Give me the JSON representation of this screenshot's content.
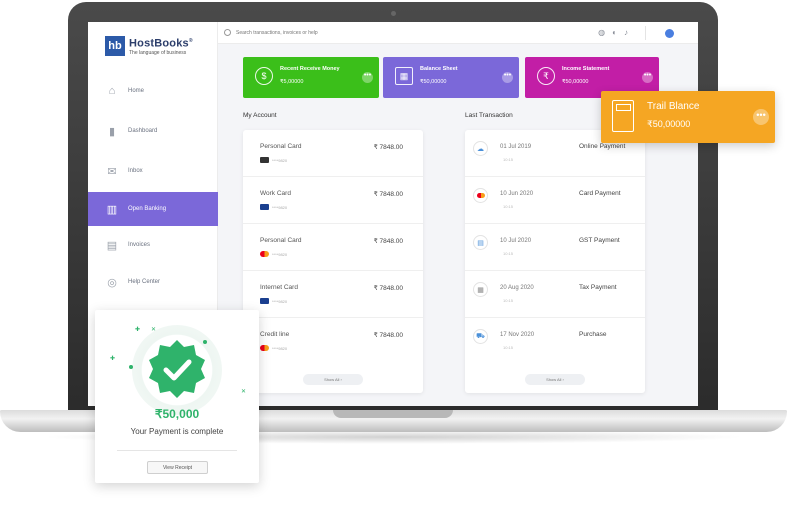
{
  "brand": {
    "logo_mark": "hb",
    "name": "HostBooks",
    "trademark": "®",
    "tagline": "The language of business"
  },
  "search": {
    "placeholder": "Search transactions, invoices or help"
  },
  "sidebar": {
    "items": [
      {
        "label": "Home",
        "icon": "home-icon"
      },
      {
        "label": "Dashboard",
        "icon": "bar-chart-icon"
      },
      {
        "label": "Inbox",
        "icon": "mail-icon"
      },
      {
        "label": "Open Banking",
        "icon": "bank-icon",
        "active": true
      },
      {
        "label": "Invoices",
        "icon": "invoice-icon"
      },
      {
        "label": "Help Center",
        "icon": "lifebuoy-icon"
      }
    ]
  },
  "tiles": [
    {
      "title": "Recent Receive Money",
      "value": "₹5,00000",
      "color": "#3bbf1a",
      "icon": "money-hand-icon"
    },
    {
      "title": "Balance Sheet",
      "value": "₹50,00000",
      "color": "#7b68d9",
      "icon": "balance-sheet-icon"
    },
    {
      "title": "Income Statement",
      "value": "₹50,00000",
      "color": "#c21ea6",
      "icon": "money-bag-icon"
    }
  ],
  "trail": {
    "title": "Trail Blance",
    "value": "₹50,00000",
    "color": "#f5a623"
  },
  "my_account": {
    "title": "My Account",
    "rows": [
      {
        "name": "Personal Card",
        "amount": "₹ 7848.00",
        "card": "****9820",
        "type": "generic"
      },
      {
        "name": "Work Card",
        "amount": "₹ 7848.00",
        "card": "****9820",
        "type": "visa"
      },
      {
        "name": "Personal Card",
        "amount": "₹ 7848.00",
        "card": "****9820",
        "type": "mastercard"
      },
      {
        "name": "Internet Card",
        "amount": "₹ 7848.00",
        "card": "****9820",
        "type": "visa"
      },
      {
        "name": "Credit line",
        "amount": "₹ 7848.00",
        "card": "****9820",
        "type": "mastercard"
      }
    ],
    "show_all": "Show All ›"
  },
  "last_transaction": {
    "title": "Last Transaction",
    "rows": [
      {
        "date": "01 Jul 2019",
        "sub": "10:15",
        "type": "Online Payment",
        "icon": "cloud-icon"
      },
      {
        "date": "10 Jun 2020",
        "sub": "10:15",
        "type": "Card Payment",
        "icon": "mastercard-icon"
      },
      {
        "date": "10 Jul 2020",
        "sub": "10:15",
        "type": "GST Payment",
        "icon": "document-icon"
      },
      {
        "date": "20 Aug 2020",
        "sub": "10:15",
        "type": "Tax Payment",
        "icon": "receipt-icon"
      },
      {
        "date": "17 Nov 2020",
        "sub": "10:15",
        "type": "Purchase",
        "icon": "cart-icon"
      }
    ],
    "show_all": "Show All ›"
  },
  "payment": {
    "amount": "₹50,000",
    "message": "Your Payment is complete",
    "button": "View Receipt",
    "color": "#2fb36b"
  }
}
